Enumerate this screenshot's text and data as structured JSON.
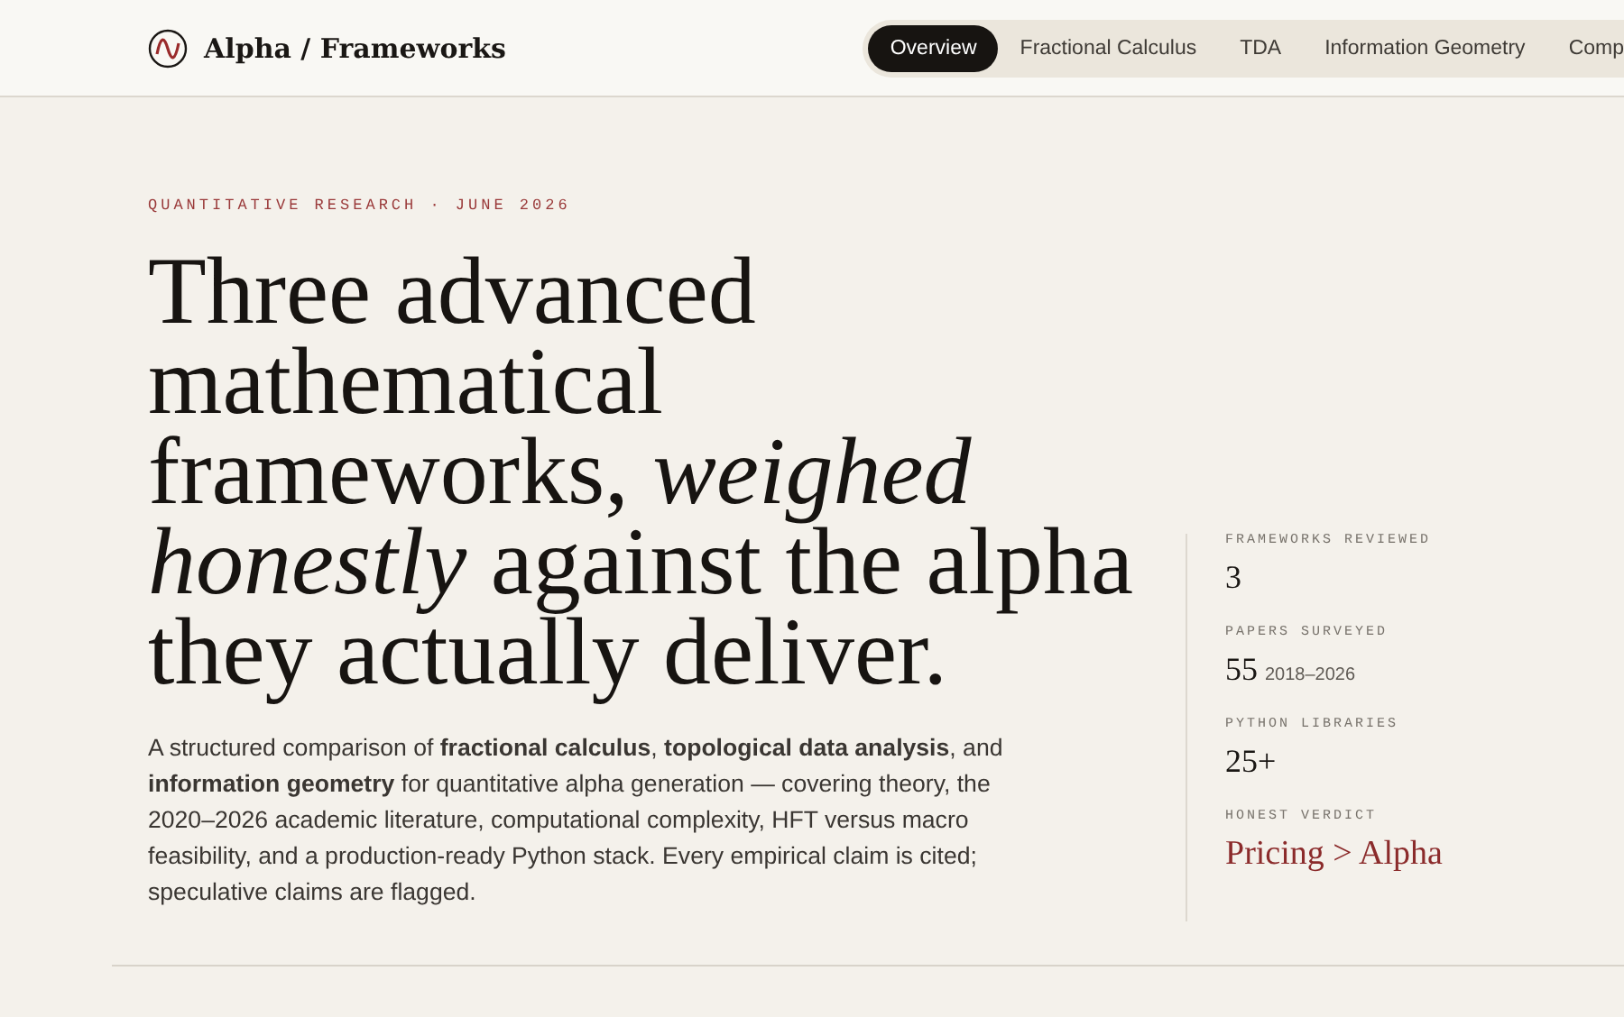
{
  "brand": {
    "title": "Alpha / Frameworks"
  },
  "nav": [
    {
      "label": "Overview",
      "selected": true
    },
    {
      "label": "Fractional Calculus",
      "selected": false
    },
    {
      "label": "TDA",
      "selected": false
    },
    {
      "label": "Information Geometry",
      "selected": false
    },
    {
      "label": "Comp",
      "selected": false
    }
  ],
  "hero": {
    "eyebrow": "QUANTITATIVE RESEARCH · JUNE 2026",
    "headline": "Three advanced mathematical frameworks, *weighed honestly* against the alpha they actually deliver.",
    "lede": "A structured comparison of **fractional calculus**, **topological data analysis**, and **information geometry** for quantitative alpha generation — covering theory, the 2020–2026 academic literature, computational complexity, HFT versus macro feasibility, and a production-ready Python stack. Every empirical claim is cited; speculative claims are flagged."
  },
  "stats": [
    {
      "kind": "number",
      "label": "FRAMEWORKS REVIEWED",
      "value": "3"
    },
    {
      "kind": "number",
      "label": "PAPERS SURVEYED",
      "value": "55",
      "note": "2018–2026"
    },
    {
      "kind": "number",
      "label": "PYTHON LIBRARIES",
      "value": "25+"
    },
    {
      "kind": "verdict",
      "label": "HONEST VERDICT",
      "value": "Pricing > Alpha"
    }
  ]
}
